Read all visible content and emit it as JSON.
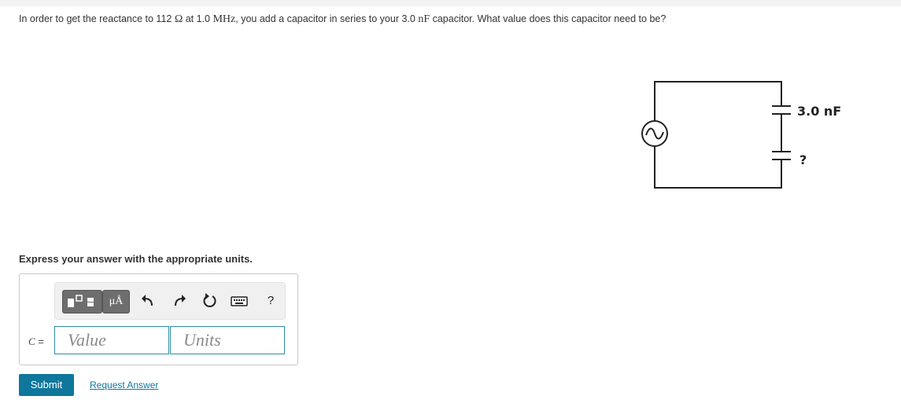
{
  "question": {
    "part1": "In order to get the reactance to 112 ",
    "ohm": "Ω",
    "part2": " at 1.0 ",
    "mhz": "MHz",
    "part3": ", you add a capacitor in series to your 3.0 ",
    "nf": "nF",
    "part4": " capacitor. What value does this capacitor need to be?"
  },
  "circuit": {
    "cap1_label": "3.0 nF",
    "cap2_label": "?",
    "source_icon": "ac-source-icon"
  },
  "instructions": "Express your answer with the appropriate units.",
  "toolbar": {
    "units_label": "μÅ",
    "undo_icon": "undo-icon",
    "redo_icon": "redo-icon",
    "reset_icon": "reset-icon",
    "keyboard_icon": "keyboard-icon",
    "help_label": "?"
  },
  "answer": {
    "variable": "C",
    "equals": " =",
    "value_placeholder": "Value",
    "units_placeholder": "Units"
  },
  "actions": {
    "submit_label": "Submit",
    "request_label": "Request Answer"
  },
  "colors": {
    "accent": "#0e779b",
    "field_border": "#2e8fa5",
    "toolbar_button": "#6e6e6e"
  }
}
